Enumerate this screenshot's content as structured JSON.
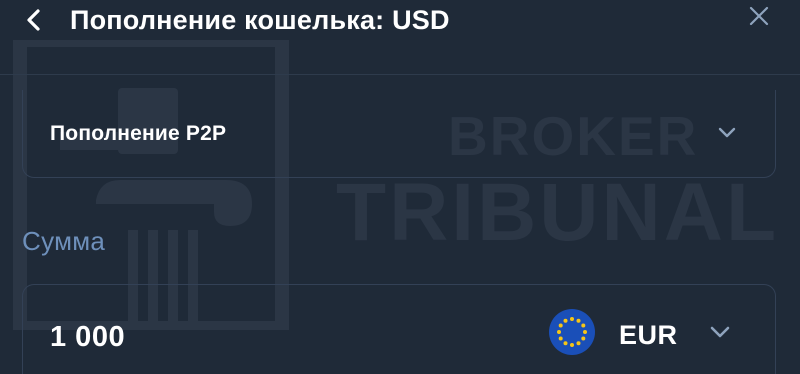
{
  "header": {
    "title": "Пополнение кошелька: USD",
    "back_icon": "chevron-left-icon",
    "close_icon": "close-icon"
  },
  "watermark": {
    "line1": "BROKER",
    "line2": "TRIBUNAL"
  },
  "deposit_method": {
    "selected": "Пополнение P2P",
    "icon": "chevron-down-icon"
  },
  "amount": {
    "label": "Сумма",
    "value": "1 000",
    "currency": "EUR",
    "currency_icon": "eu-flag-icon"
  },
  "colors": {
    "background": "#1f2a38",
    "border": "#334156",
    "label_blue": "#6e90bb",
    "watermark": "#2b3645",
    "flag_blue": "#1a4fb8",
    "flag_stars": "#f5c518"
  }
}
